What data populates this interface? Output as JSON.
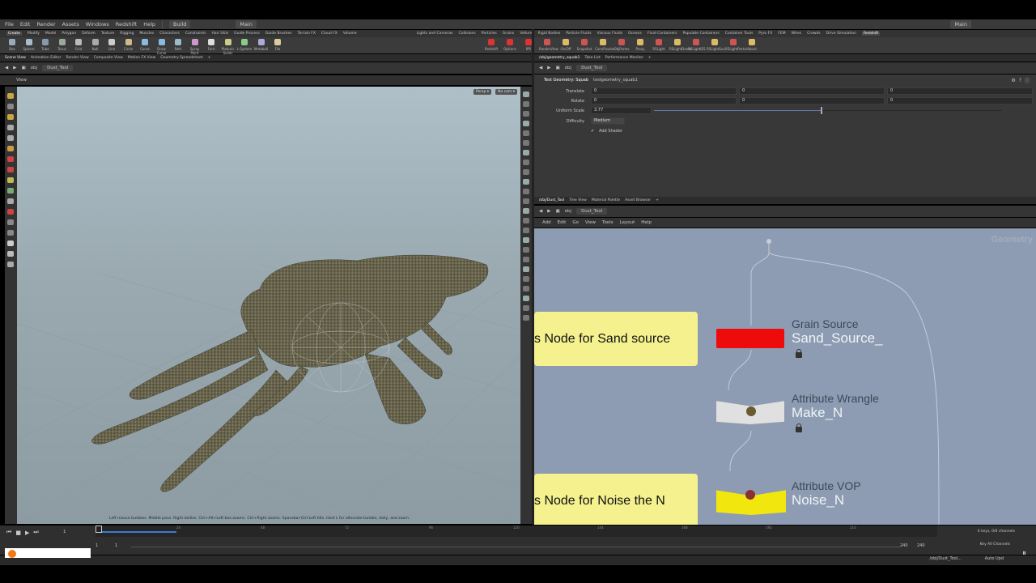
{
  "menu": {
    "items": [
      "File",
      "Edit",
      "Render",
      "Assets",
      "Windows",
      "Redshift",
      "Help"
    ],
    "desktop_left": "Build",
    "desktop_center": "Main",
    "desktop_right": "Main"
  },
  "shelf_tabs_left": [
    "Create",
    "Modify",
    "Model",
    "Polygon",
    "Deform",
    "Texture",
    "Rigging",
    "Muscles",
    "Characters",
    "Constraints",
    "Hair Utils",
    "Guide Process",
    "Guide Brushes",
    "Terrain FX",
    "Cloud FX",
    "Volume"
  ],
  "shelf_tabs_right": [
    "Lights and Cameras",
    "Collisions",
    "Particles",
    "Grains",
    "Vellum",
    "Rigid Bodies",
    "Particle Fluids",
    "Viscous Fluids",
    "Oceans",
    "Fluid Containers",
    "Populate Containers",
    "Container Tools",
    "Pyro FX",
    "FEM",
    "Wires",
    "Crowds",
    "Drive Simulation",
    "Redshift"
  ],
  "shelf_tools_left": [
    "Box",
    "Sphere",
    "Tube",
    "Torus",
    "Grid",
    "Null",
    "Line",
    "Circle",
    "Curve",
    "Draw Curve",
    "Path",
    "Spray Paint",
    "Font",
    "Platonic Solids",
    "L-System",
    "Metaball",
    "File"
  ],
  "shelf_tools_right": [
    "Redshift",
    "Options",
    "IPR",
    "RenderView",
    "On/Off",
    "Snapshot",
    "ConnProxies",
    "ObjParms",
    "Proxy",
    "RSLight",
    "RSLightDome",
    "RSLightIES",
    "RSLightSun",
    "RSLightPortal",
    "About"
  ],
  "pane_tabs_left": [
    "Scene View",
    "Animation Editor",
    "Render View",
    "Composite View",
    "Motion FX View",
    "Geometry Spreadsheet"
  ],
  "pane_tabs_right_top": [
    "/obj/geometry_squab1",
    "Take List",
    "Performance Monitor"
  ],
  "pane_tabs_right_bottom": [
    "/obj/Dust_Tool",
    "Tree View",
    "Material Palette",
    "Asset Browser"
  ],
  "path": {
    "root": "obj",
    "node": "Dust_Tool"
  },
  "viewport": {
    "title": "View",
    "persp": "Persp ▾",
    "cam": "No cam ▾",
    "hint": "Left mouse tumbles. Middle pans. Right dollies. Ctrl+Alt+Left box-zooms. Ctrl+Right zooms. Spacebar-Ctrl-Left tilts. Hold L for alternate tumble, dolly, and zoom."
  },
  "params": {
    "header_label": "Test Geometry: Squab",
    "header_value": "testgeometry_squab1",
    "translate_label": "Translate",
    "translate": [
      "0",
      "0",
      "0"
    ],
    "rotate_label": "Rotate",
    "rotate": [
      "0",
      "0",
      "0"
    ],
    "uniform_scale_label": "Uniform Scale",
    "uniform_scale": "3.77",
    "uniform_scale_slider": 0.48,
    "difficulty_label": "Difficulty",
    "difficulty": "Medium",
    "add_shader": "Add Shader"
  },
  "network": {
    "menu": [
      "Add",
      "Edit",
      "Go",
      "View",
      "Tools",
      "Layout",
      "Help"
    ],
    "context_label": "Geometry",
    "sticky1": "s Node for Sand source",
    "sticky2": "s Node for Noise the N",
    "nodes": [
      {
        "type": "Grain Source",
        "name": "Sand_Source_",
        "color": "#ee0b0b"
      },
      {
        "type": "Attribute Wrangle",
        "name": "Make_N",
        "color": "#e0e0e0"
      },
      {
        "type": "Attribute VOP",
        "name": "Noise_N",
        "color": "#f2e60f"
      }
    ]
  },
  "timeline": {
    "frame": "1",
    "ticks": [
      "24",
      "48",
      "72",
      "96",
      "120",
      "144",
      "168",
      "192",
      "216"
    ],
    "start": "1",
    "start2": "1",
    "end": "240",
    "end2": "240",
    "keys": "0 keys, 0/0 channels",
    "key_all": "Key All Channels",
    "playhead_fraction": 0.0
  },
  "status": {
    "path": "/obj/Dust_Tool...",
    "auto": "Auto Upd"
  }
}
